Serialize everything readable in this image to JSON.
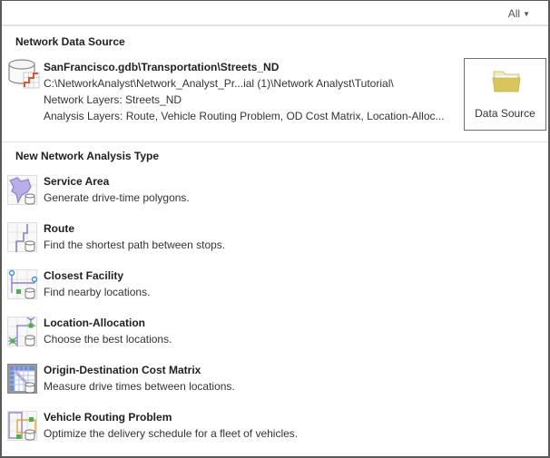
{
  "filter": {
    "label": "All",
    "chevron_icon": "chevron-down-icon"
  },
  "data_source_section": {
    "title": "Network Data Source",
    "icon": "network-dataset-icon",
    "name": "SanFrancisco.gdb\\Transportation\\Streets_ND",
    "path": "C:\\NetworkAnalyst\\Network_Analyst_Pr...ial (1)\\Network Analyst\\Tutorial\\",
    "network_layers": "Network Layers: Streets_ND",
    "analysis_layers": "Analysis Layers: Route, Vehicle Routing Problem, OD Cost Matrix, Location-Alloc...",
    "button": {
      "label": "Data Source",
      "icon": "folder-icon"
    }
  },
  "analysis_section": {
    "title": "New Network Analysis Type",
    "items": [
      {
        "title": "Service Area",
        "description": "Generate drive-time polygons.",
        "icon": "service-area-icon"
      },
      {
        "title": "Route",
        "description": "Find the shortest path between stops.",
        "icon": "route-icon"
      },
      {
        "title": "Closest Facility",
        "description": "Find nearby locations.",
        "icon": "closest-facility-icon"
      },
      {
        "title": "Location-Allocation",
        "description": "Choose the best locations.",
        "icon": "location-allocation-icon"
      },
      {
        "title": "Origin-Destination Cost Matrix",
        "description": "Measure drive times between locations.",
        "icon": "od-cost-matrix-icon"
      },
      {
        "title": "Vehicle Routing Problem",
        "description": "Optimize the delivery schedule for a fleet of vehicles.",
        "icon": "vehicle-routing-icon"
      }
    ]
  },
  "colors": {
    "purple": "#8f7fd1",
    "orange": "#f0a030",
    "green": "#4caf50",
    "blue": "#3c8fd6",
    "folder": "#d9c65a"
  }
}
